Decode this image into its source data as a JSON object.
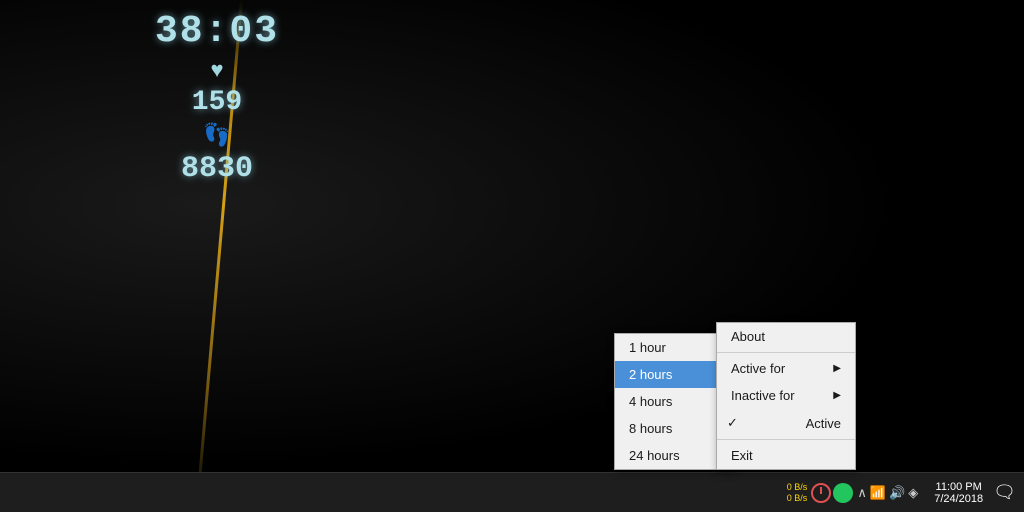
{
  "background": {
    "color": "#000000"
  },
  "tracker": {
    "time": "38:03",
    "heart_icon": "♥",
    "steps_count": "159",
    "feet_icon": "👣",
    "calories": "8830"
  },
  "hours_menu": {
    "items": [
      {
        "label": "1 hour",
        "selected": false
      },
      {
        "label": "2 hours",
        "selected": true
      },
      {
        "label": "4 hours",
        "selected": false
      },
      {
        "label": "8 hours",
        "selected": false
      },
      {
        "label": "24 hours",
        "selected": false
      }
    ]
  },
  "main_menu": {
    "items": [
      {
        "label": "About",
        "has_arrow": false,
        "checked": false
      },
      {
        "label": "Active for",
        "has_arrow": true,
        "checked": false
      },
      {
        "label": "Inactive for",
        "has_arrow": true,
        "checked": false
      },
      {
        "label": "Active",
        "has_arrow": false,
        "checked": true
      },
      {
        "label": "Exit",
        "has_arrow": false,
        "checked": false
      }
    ]
  },
  "taskbar": {
    "net_up": "0 B/s",
    "net_down": "0 B/s",
    "time": "11:00 PM",
    "date": "7/24/2018"
  }
}
